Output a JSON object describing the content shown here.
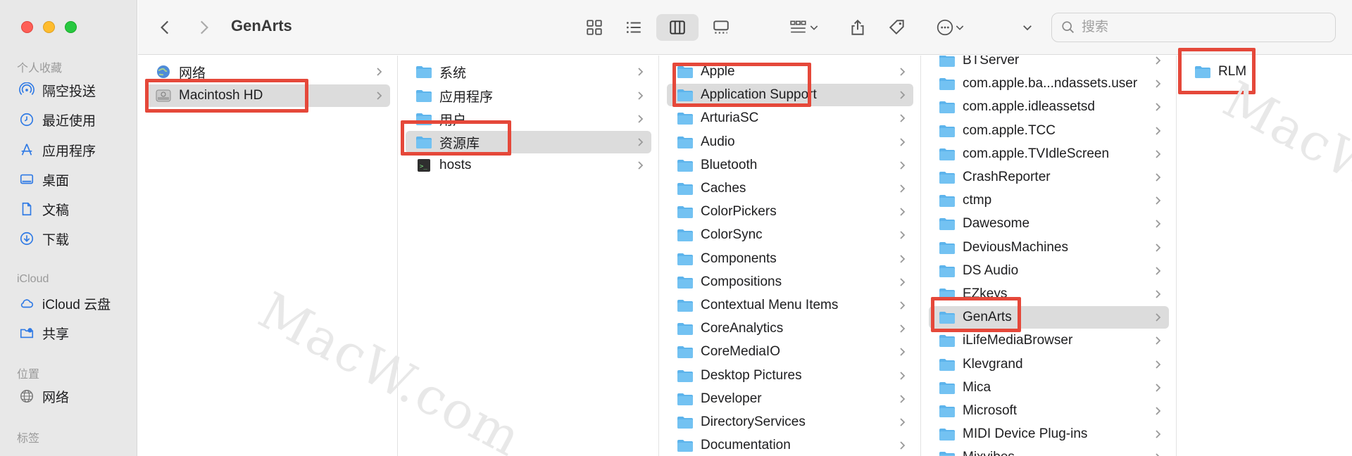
{
  "window": {
    "title": "GenArts"
  },
  "sidebar": {
    "sections": [
      {
        "label": "个人收藏",
        "items": [
          {
            "label": "隔空投送",
            "icon": "airdrop-icon"
          },
          {
            "label": "最近使用",
            "icon": "clock-icon"
          },
          {
            "label": "应用程序",
            "icon": "applications-icon"
          },
          {
            "label": "桌面",
            "icon": "desktop-icon"
          },
          {
            "label": "文稿",
            "icon": "document-icon"
          },
          {
            "label": "下载",
            "icon": "download-icon"
          }
        ]
      },
      {
        "label": "iCloud",
        "items": [
          {
            "label": "iCloud 云盘",
            "icon": "cloud-icon"
          },
          {
            "label": "共享",
            "icon": "shared-folder-icon"
          }
        ]
      },
      {
        "label": "位置",
        "items": [
          {
            "label": "网络",
            "icon": "network-globe-icon"
          }
        ]
      },
      {
        "label": "标签",
        "items": []
      }
    ]
  },
  "toolbar": {
    "search_placeholder": "搜索",
    "buttons": [
      "back-icon",
      "forward-icon",
      "icon-view-icon",
      "list-view-icon",
      "column-view-icon",
      "gallery-view-icon",
      "group-icon",
      "share-icon",
      "tag-icon",
      "more-icon",
      "chevron-down-icon"
    ],
    "active_view": "column"
  },
  "columns": [
    {
      "items": [
        {
          "name": "网络",
          "icon": "globe",
          "chevron": true,
          "selected": false
        },
        {
          "name": "Macintosh HD",
          "icon": "disk",
          "chevron": true,
          "selected": true
        }
      ]
    },
    {
      "items": [
        {
          "name": "系统",
          "icon": "folder",
          "chevron": true,
          "selected": false
        },
        {
          "name": "应用程序",
          "icon": "folder",
          "chevron": true,
          "selected": false
        },
        {
          "name": "用户",
          "icon": "folder",
          "chevron": true,
          "selected": false
        },
        {
          "name": "资源库",
          "icon": "folder",
          "chevron": true,
          "selected": true
        },
        {
          "name": "hosts",
          "icon": "exec",
          "chevron": true,
          "selected": false
        }
      ]
    },
    {
      "items": [
        {
          "name": "Apple",
          "icon": "folder",
          "chevron": true,
          "selected": false
        },
        {
          "name": "Application Support",
          "icon": "folder",
          "chevron": true,
          "selected": true
        },
        {
          "name": "ArturiaSC",
          "icon": "folder",
          "chevron": true,
          "selected": false
        },
        {
          "name": "Audio",
          "icon": "folder",
          "chevron": true,
          "selected": false
        },
        {
          "name": "Bluetooth",
          "icon": "folder",
          "chevron": true,
          "selected": false
        },
        {
          "name": "Caches",
          "icon": "folder",
          "chevron": true,
          "selected": false
        },
        {
          "name": "ColorPickers",
          "icon": "folder",
          "chevron": true,
          "selected": false
        },
        {
          "name": "ColorSync",
          "icon": "folder",
          "chevron": true,
          "selected": false
        },
        {
          "name": "Components",
          "icon": "folder",
          "chevron": true,
          "selected": false
        },
        {
          "name": "Compositions",
          "icon": "folder",
          "chevron": true,
          "selected": false
        },
        {
          "name": "Contextual Menu Items",
          "icon": "folder",
          "chevron": true,
          "selected": false
        },
        {
          "name": "CoreAnalytics",
          "icon": "folder",
          "chevron": true,
          "selected": false
        },
        {
          "name": "CoreMediaIO",
          "icon": "folder",
          "chevron": true,
          "selected": false
        },
        {
          "name": "Desktop Pictures",
          "icon": "folder",
          "chevron": true,
          "selected": false
        },
        {
          "name": "Developer",
          "icon": "folder",
          "chevron": true,
          "selected": false
        },
        {
          "name": "DirectoryServices",
          "icon": "folder",
          "chevron": true,
          "selected": false
        },
        {
          "name": "Documentation",
          "icon": "folder",
          "chevron": true,
          "selected": false
        }
      ]
    },
    {
      "items": [
        {
          "name": "BTServer",
          "icon": "folder",
          "chevron": true,
          "selected": false
        },
        {
          "name": "com.apple.ba...ndassets.user",
          "icon": "folder",
          "chevron": true,
          "selected": false
        },
        {
          "name": "com.apple.idleassetsd",
          "icon": "folder",
          "chevron": true,
          "selected": false
        },
        {
          "name": "com.apple.TCC",
          "icon": "folder",
          "chevron": true,
          "selected": false
        },
        {
          "name": "com.apple.TVIdleScreen",
          "icon": "folder",
          "chevron": true,
          "selected": false
        },
        {
          "name": "CrashReporter",
          "icon": "folder",
          "chevron": true,
          "selected": false
        },
        {
          "name": "ctmp",
          "icon": "folder",
          "chevron": true,
          "selected": false
        },
        {
          "name": "Dawesome",
          "icon": "folder",
          "chevron": true,
          "selected": false
        },
        {
          "name": "DeviousMachines",
          "icon": "folder",
          "chevron": true,
          "selected": false
        },
        {
          "name": "DS Audio",
          "icon": "folder",
          "chevron": true,
          "selected": false
        },
        {
          "name": "EZkeys",
          "icon": "folder",
          "chevron": true,
          "selected": false
        },
        {
          "name": "GenArts",
          "icon": "folder",
          "chevron": true,
          "selected": true
        },
        {
          "name": "iLifeMediaBrowser",
          "icon": "folder",
          "chevron": true,
          "selected": false
        },
        {
          "name": "Klevgrand",
          "icon": "folder",
          "chevron": true,
          "selected": false
        },
        {
          "name": "Mica",
          "icon": "folder",
          "chevron": true,
          "selected": false
        },
        {
          "name": "Microsoft",
          "icon": "folder",
          "chevron": true,
          "selected": false
        },
        {
          "name": "MIDI Device Plug-ins",
          "icon": "folder",
          "chevron": true,
          "selected": false
        },
        {
          "name": "Mixvibes",
          "icon": "folder",
          "chevron": true,
          "selected": false
        }
      ]
    },
    {
      "items": [
        {
          "name": "RLM",
          "icon": "folder",
          "chevron": false,
          "selected": false
        }
      ]
    }
  ],
  "watermark": "MacW.com",
  "colors": {
    "highlight_box": "#e5483a",
    "folder": "#5db4ec",
    "selection": "#dcdcdc"
  }
}
